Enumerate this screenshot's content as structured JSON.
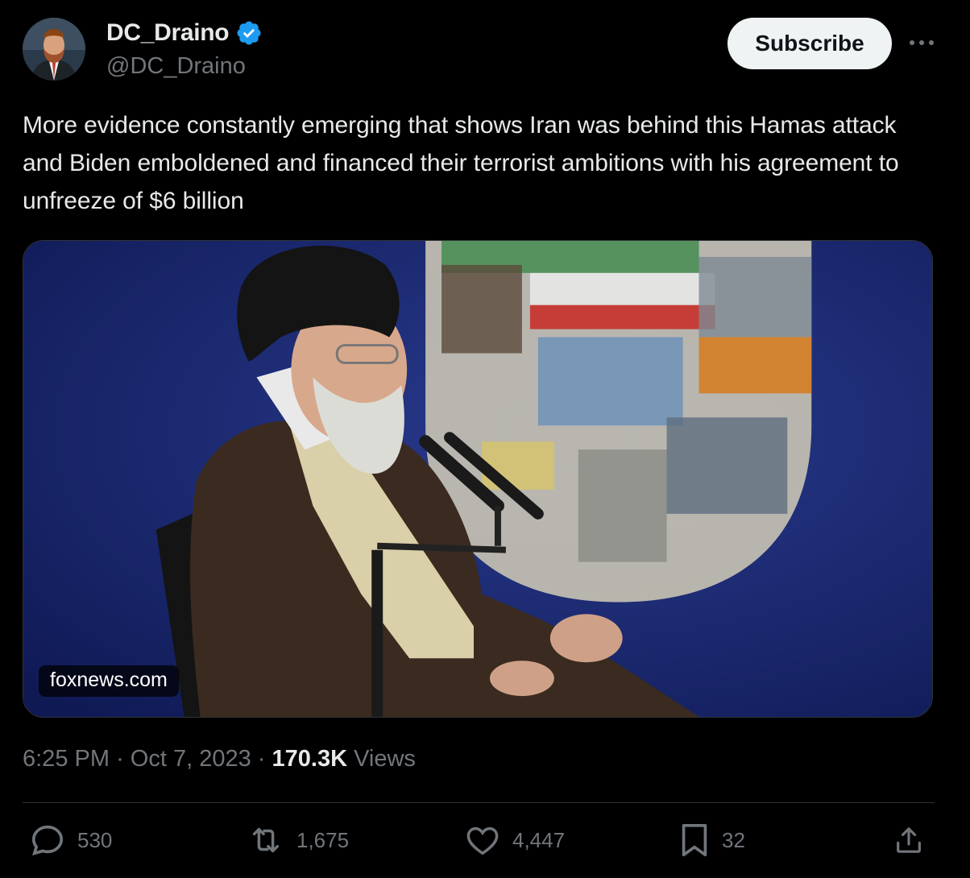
{
  "author": {
    "display_name": "DC_Draino",
    "handle": "@DC_Draino",
    "verified": true
  },
  "subscribe_label": "Subscribe",
  "tweet": {
    "text": "More evidence constantly emerging that shows Iran was behind this Hamas attack and Biden emboldened and financed their terrorist ambitions with his agreement to unfreeze of $6 billion"
  },
  "media": {
    "source": "foxnews.com"
  },
  "meta": {
    "time": "6:25 PM",
    "date": "Oct 7, 2023",
    "views_count": "170.3K",
    "views_label": "Views"
  },
  "actions": {
    "replies": "530",
    "reposts": "1,675",
    "likes": "4,447",
    "bookmarks": "32"
  },
  "colors": {
    "background": "#000000",
    "text": "#e7e9ea",
    "muted": "#71767b",
    "verified": "#1d9bf0",
    "border": "#2f3336"
  }
}
